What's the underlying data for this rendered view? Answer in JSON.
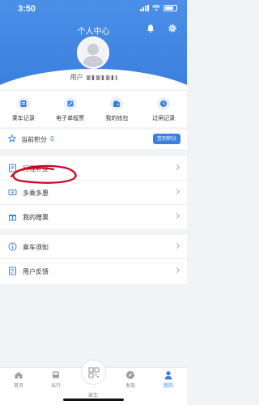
{
  "status_bar": {
    "time": "3:50"
  },
  "header": {
    "title": "个人中心",
    "user_prefix": "用户"
  },
  "quick_nav": [
    {
      "label": "乘车记录",
      "icon": "ticket-record-icon"
    },
    {
      "label": "电子单程票",
      "icon": "e-ticket-icon"
    },
    {
      "label": "我的钱包",
      "icon": "wallet-icon"
    },
    {
      "label": "过闸记录",
      "icon": "clock-icon"
    }
  ],
  "points": {
    "label": "当前积分",
    "value": "0",
    "signin": "签到积分"
  },
  "menu_group_1": [
    {
      "label": "行程补登",
      "icon": "trip-supplement-icon"
    },
    {
      "label": "多乘多惠",
      "icon": "discount-ticket-icon"
    },
    {
      "label": "我的赠票",
      "icon": "gift-icon"
    }
  ],
  "menu_group_2": [
    {
      "label": "乘车须知",
      "icon": "info-icon"
    },
    {
      "label": "用户反馈",
      "icon": "feedback-icon"
    }
  ],
  "tabbar": [
    {
      "label": "首页",
      "icon": "home-icon"
    },
    {
      "label": "出行",
      "icon": "train-icon"
    },
    {
      "label": "乘车",
      "icon": "qr-code-icon"
    },
    {
      "label": "发现",
      "icon": "compass-icon"
    },
    {
      "label": "我的",
      "icon": "person-icon",
      "active": true
    }
  ],
  "colors": {
    "accent": "#3b7fdd",
    "annotation": "#d0021b"
  }
}
